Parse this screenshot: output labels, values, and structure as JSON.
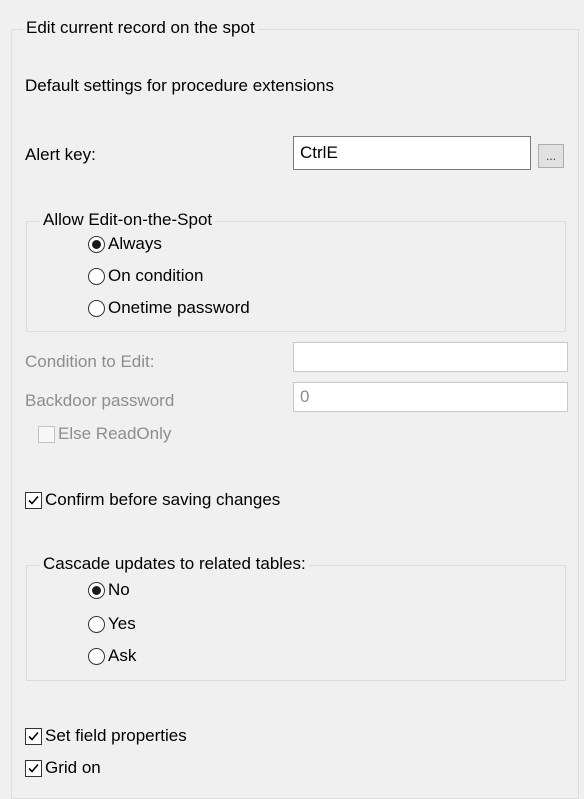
{
  "outer_group": {
    "title": "Edit current record on the spot"
  },
  "section_heading": "Default settings for procedure extensions",
  "alert_key": {
    "label": "Alert key:",
    "value": "CtrlE",
    "browse_label": "..."
  },
  "allow_group": {
    "title": "Allow Edit-on-the-Spot",
    "options": [
      {
        "label": "Always",
        "selected": true
      },
      {
        "label": "On condition",
        "selected": false
      },
      {
        "label": "Onetime password",
        "selected": false
      }
    ]
  },
  "condition": {
    "label": "Condition to Edit:",
    "value": ""
  },
  "backdoor": {
    "label": "Backdoor password",
    "value": "0"
  },
  "else_readonly": {
    "label": "Else ReadOnly",
    "checked": false
  },
  "confirm_save": {
    "label": "Confirm before saving changes",
    "checked": true
  },
  "cascade_group": {
    "title": "Cascade updates to related tables:",
    "options": [
      {
        "label": "No",
        "selected": true
      },
      {
        "label": "Yes",
        "selected": false
      },
      {
        "label": "Ask",
        "selected": false
      }
    ]
  },
  "set_field_props": {
    "label": "Set field properties",
    "checked": true
  },
  "grid_on": {
    "label": "Grid on",
    "checked": true
  },
  "colors": {
    "background": "#f0f0f0",
    "disabled_text": "#8d8d8d",
    "border": "#dcdcdc"
  }
}
